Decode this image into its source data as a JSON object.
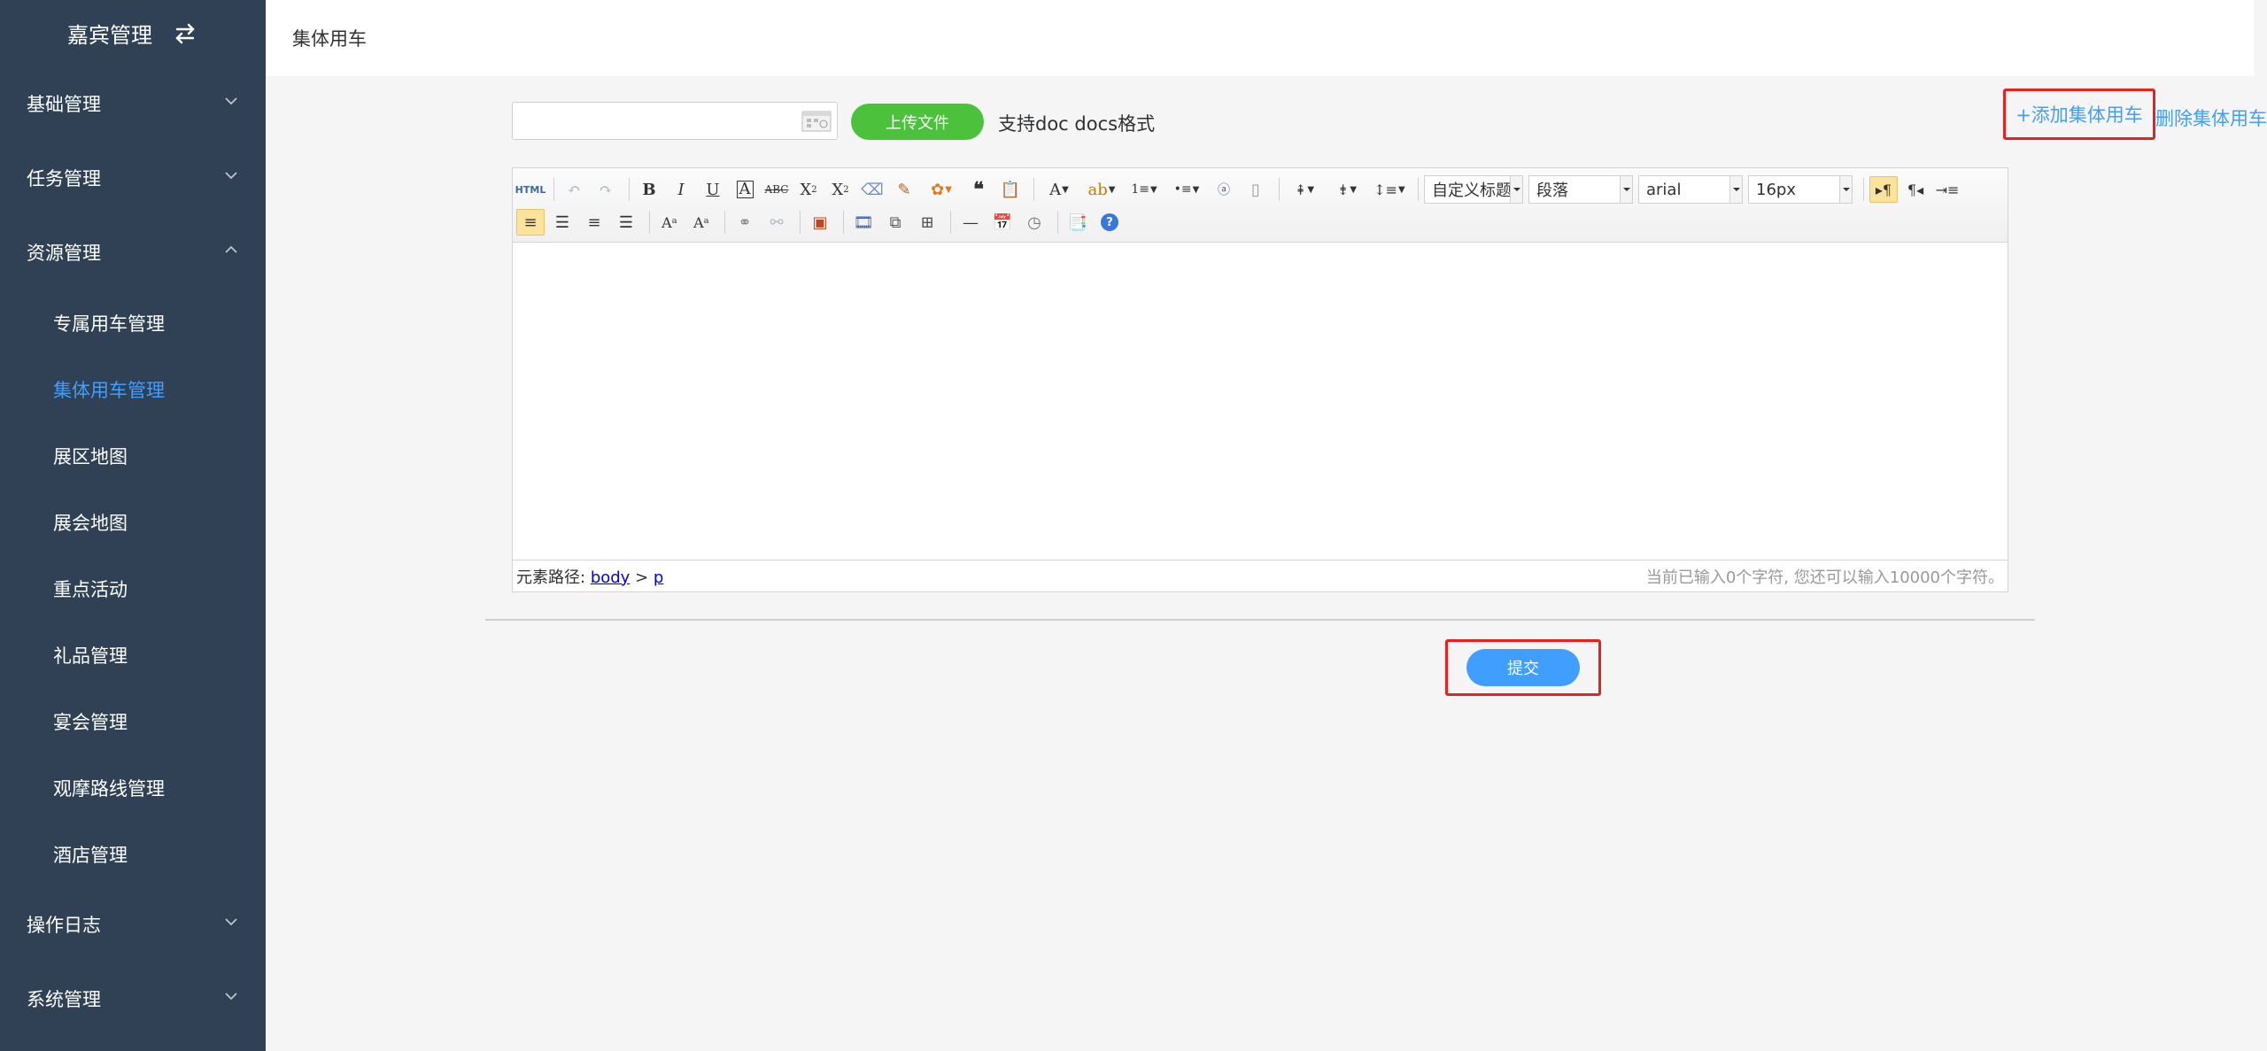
{
  "sidebar": {
    "title": "嘉宾管理",
    "menus": [
      {
        "label": "基础管理"
      },
      {
        "label": "任务管理"
      },
      {
        "label": "资源管理"
      },
      {
        "label": "操作日志"
      },
      {
        "label": "系统管理"
      }
    ],
    "resource_items": [
      {
        "label": "专属用车管理"
      },
      {
        "label": "集体用车管理"
      },
      {
        "label": "展区地图"
      },
      {
        "label": "展会地图"
      },
      {
        "label": "重点活动"
      },
      {
        "label": "礼品管理"
      },
      {
        "label": "宴会管理"
      },
      {
        "label": "观摩路线管理"
      },
      {
        "label": "酒店管理"
      }
    ],
    "active_item": "集体用车管理"
  },
  "header": {
    "breadcrumb": "集体用车"
  },
  "upload": {
    "file_value": "",
    "button_label": "上传文件",
    "hint": "支持doc docs格式"
  },
  "actions": {
    "add_label": "+添加集体用车",
    "delete_label": "删除集体用车"
  },
  "editor": {
    "toolbar": {
      "html_label": "HTML",
      "custom_title": "自定义标题",
      "paragraph": "段落",
      "font_family": "arial",
      "font_size": "16px"
    },
    "status": {
      "path_label": "元素路径:",
      "path_body": "body",
      "path_sep": ">",
      "path_p": "p",
      "counter": "当前已输入0个字符, 您还可以输入10000个字符。"
    }
  },
  "form": {
    "submit_label": "提交"
  },
  "colors": {
    "sidebar_bg": "#304156",
    "accent": "#409eff",
    "upload_green": "#4cc23c",
    "highlight_red": "#e8201f"
  }
}
